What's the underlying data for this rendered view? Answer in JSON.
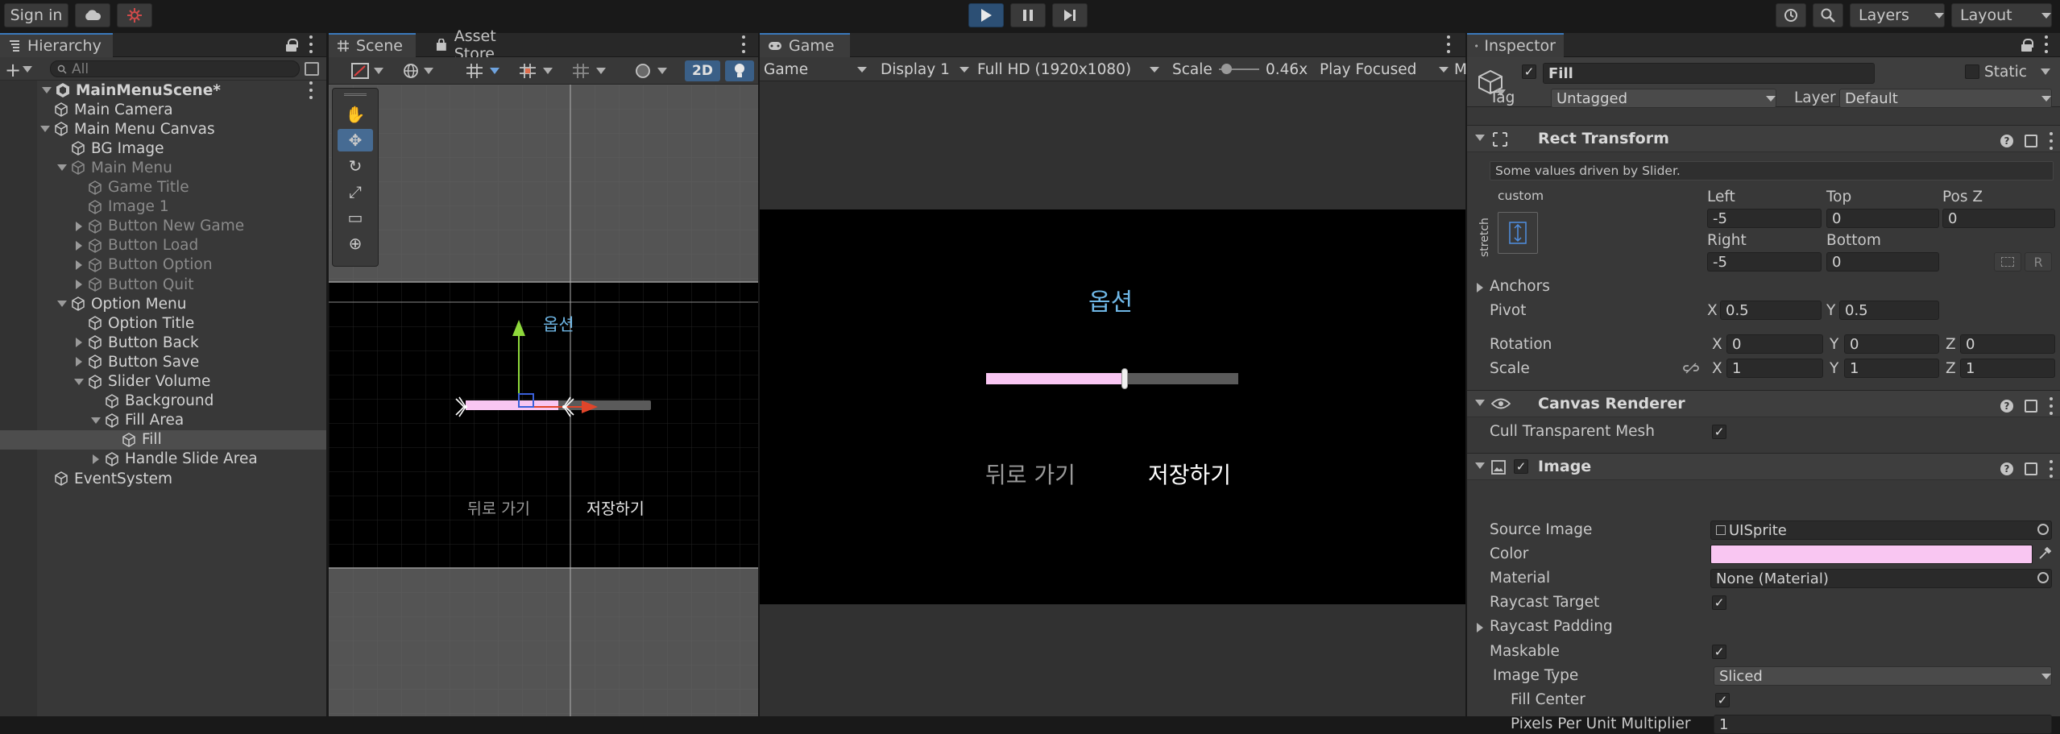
{
  "topbar": {
    "sign_in": "Sign in",
    "cloud_icon": "cloud-icon",
    "collab_icon": "collab-icon",
    "play_icon": "play-icon",
    "pause_icon": "pause-icon",
    "step_icon": "step-icon",
    "history_icon": "history-icon",
    "search_icon": "search-icon",
    "layers_label": "Layers",
    "layout_label": "Layout",
    "play_active_color": "#2c4f74"
  },
  "hierarchy": {
    "tab_label": "Hierarchy",
    "search_placeholder": "All",
    "add_label": "+",
    "items": [
      {
        "label": "MainMenuScene*",
        "icon": "unity-scene-icon"
      },
      {
        "label": "Main Camera",
        "icon": "cube-icon"
      },
      {
        "label": "Main Menu Canvas",
        "icon": "cube-icon"
      },
      {
        "label": "BG Image",
        "icon": "cube-icon"
      },
      {
        "label": "Main Menu",
        "icon": "cube-icon"
      },
      {
        "label": "Game Title",
        "icon": "cube-icon"
      },
      {
        "label": "Image 1",
        "icon": "cube-icon"
      },
      {
        "label": "Button New Game",
        "icon": "cube-icon"
      },
      {
        "label": "Button Load",
        "icon": "cube-icon"
      },
      {
        "label": "Button Option",
        "icon": "cube-icon"
      },
      {
        "label": "Button Quit",
        "icon": "cube-icon"
      },
      {
        "label": "Option Menu",
        "icon": "cube-icon"
      },
      {
        "label": "Option Title",
        "icon": "cube-icon"
      },
      {
        "label": "Button Back",
        "icon": "cube-icon"
      },
      {
        "label": "Button Save",
        "icon": "cube-icon"
      },
      {
        "label": "Slider Volume",
        "icon": "cube-icon"
      },
      {
        "label": "Background",
        "icon": "cube-icon"
      },
      {
        "label": "Fill Area",
        "icon": "cube-icon"
      },
      {
        "label": "Fill",
        "icon": "cube-icon"
      },
      {
        "label": "Handle Slide Area",
        "icon": "cube-icon"
      },
      {
        "label": "EventSystem",
        "icon": "cube-icon"
      }
    ]
  },
  "scene": {
    "tab_scene": "Scene",
    "tab_asset_store": "Asset Store",
    "btn_2d": "2D",
    "option_title": "옵션",
    "back_label": "뒤로 가기",
    "save_label": "저장하기",
    "slider_value": 0.5
  },
  "game": {
    "tab_label": "Game",
    "game_dropdown": "Game",
    "display": "Display 1",
    "resolution": "Full HD (1920x1080)",
    "scale_label": "Scale",
    "scale_value": "0.46x",
    "play_focused": "Play Focused",
    "overflow_label": "M",
    "option_title": "옵션",
    "back_label": "뒤로 가기",
    "save_label": "저장하기",
    "slider_value": 0.55
  },
  "inspector": {
    "tab_label": "Inspector",
    "object_name": "Fill",
    "static_label": "Static",
    "tag_label": "Tag",
    "tag_value": "Untagged",
    "layer_label": "Layer",
    "layer_value": "Default",
    "rect_transform": {
      "title": "Rect Transform",
      "note": "Some values driven by Slider.",
      "anchor_preset_label": "custom",
      "stretch_label": "stretch",
      "left_label": "Left",
      "left": "-5",
      "top_label": "Top",
      "top": "0",
      "posz_label": "Pos Z",
      "posz": "0",
      "right_label": "Right",
      "right": "-5",
      "bottom_label": "Bottom",
      "bottom": "0",
      "r_btn": "R",
      "anchors_label": "Anchors",
      "pivot_label": "Pivot",
      "pivot_x": "0.5",
      "pivot_y": "0.5",
      "rotation_label": "Rotation",
      "rot_x": "0",
      "rot_y": "0",
      "rot_z": "0",
      "scale_label": "Scale",
      "scale_x": "1",
      "scale_y": "1",
      "scale_z": "1",
      "x": "X",
      "y": "Y",
      "z": "Z"
    },
    "canvas_renderer": {
      "title": "Canvas Renderer",
      "cull_label": "Cull Transparent Mesh"
    },
    "image": {
      "title": "Image",
      "source_image_label": "Source Image",
      "source_image": "UISprite",
      "color_label": "Color",
      "color": "#f9c6f2",
      "material_label": "Material",
      "material": "None (Material)",
      "raycast_target_label": "Raycast Target",
      "raycast_padding_label": "Raycast Padding",
      "maskable_label": "Maskable",
      "image_type_label": "Image Type",
      "image_type": "Sliced",
      "fill_center_label": "Fill Center",
      "ppu_label": "Pixels Per Unit Multiplier",
      "ppu": "1"
    }
  },
  "colors": {
    "slider_fill": "#f9c6f2",
    "slider_bg": "#5a5a5a",
    "option_title": "#6fb7e6",
    "selection": "#4d4d4d",
    "active_tab": "#3a79bb"
  }
}
